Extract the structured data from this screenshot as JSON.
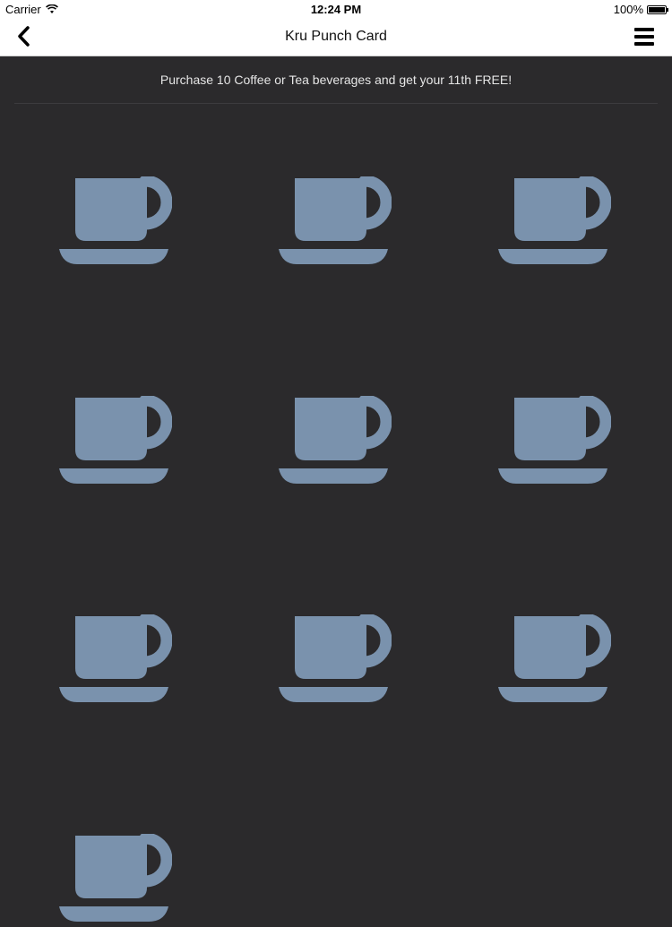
{
  "status_bar": {
    "carrier": "Carrier",
    "time": "12:24 PM",
    "battery": "100%"
  },
  "nav": {
    "title": "Kru Punch Card",
    "back_icon": "chevron-left-icon",
    "menu_icon": "hamburger-menu-icon"
  },
  "promo_text": "Purchase 10 Coffee or Tea beverages and get your 11th FREE!",
  "punch_card": {
    "cups": 10,
    "cup_icon": "coffee-cup-icon",
    "cup_color": "#7a92ad"
  },
  "colors": {
    "background": "#2b2a2c",
    "nav_background": "#ffffff"
  }
}
